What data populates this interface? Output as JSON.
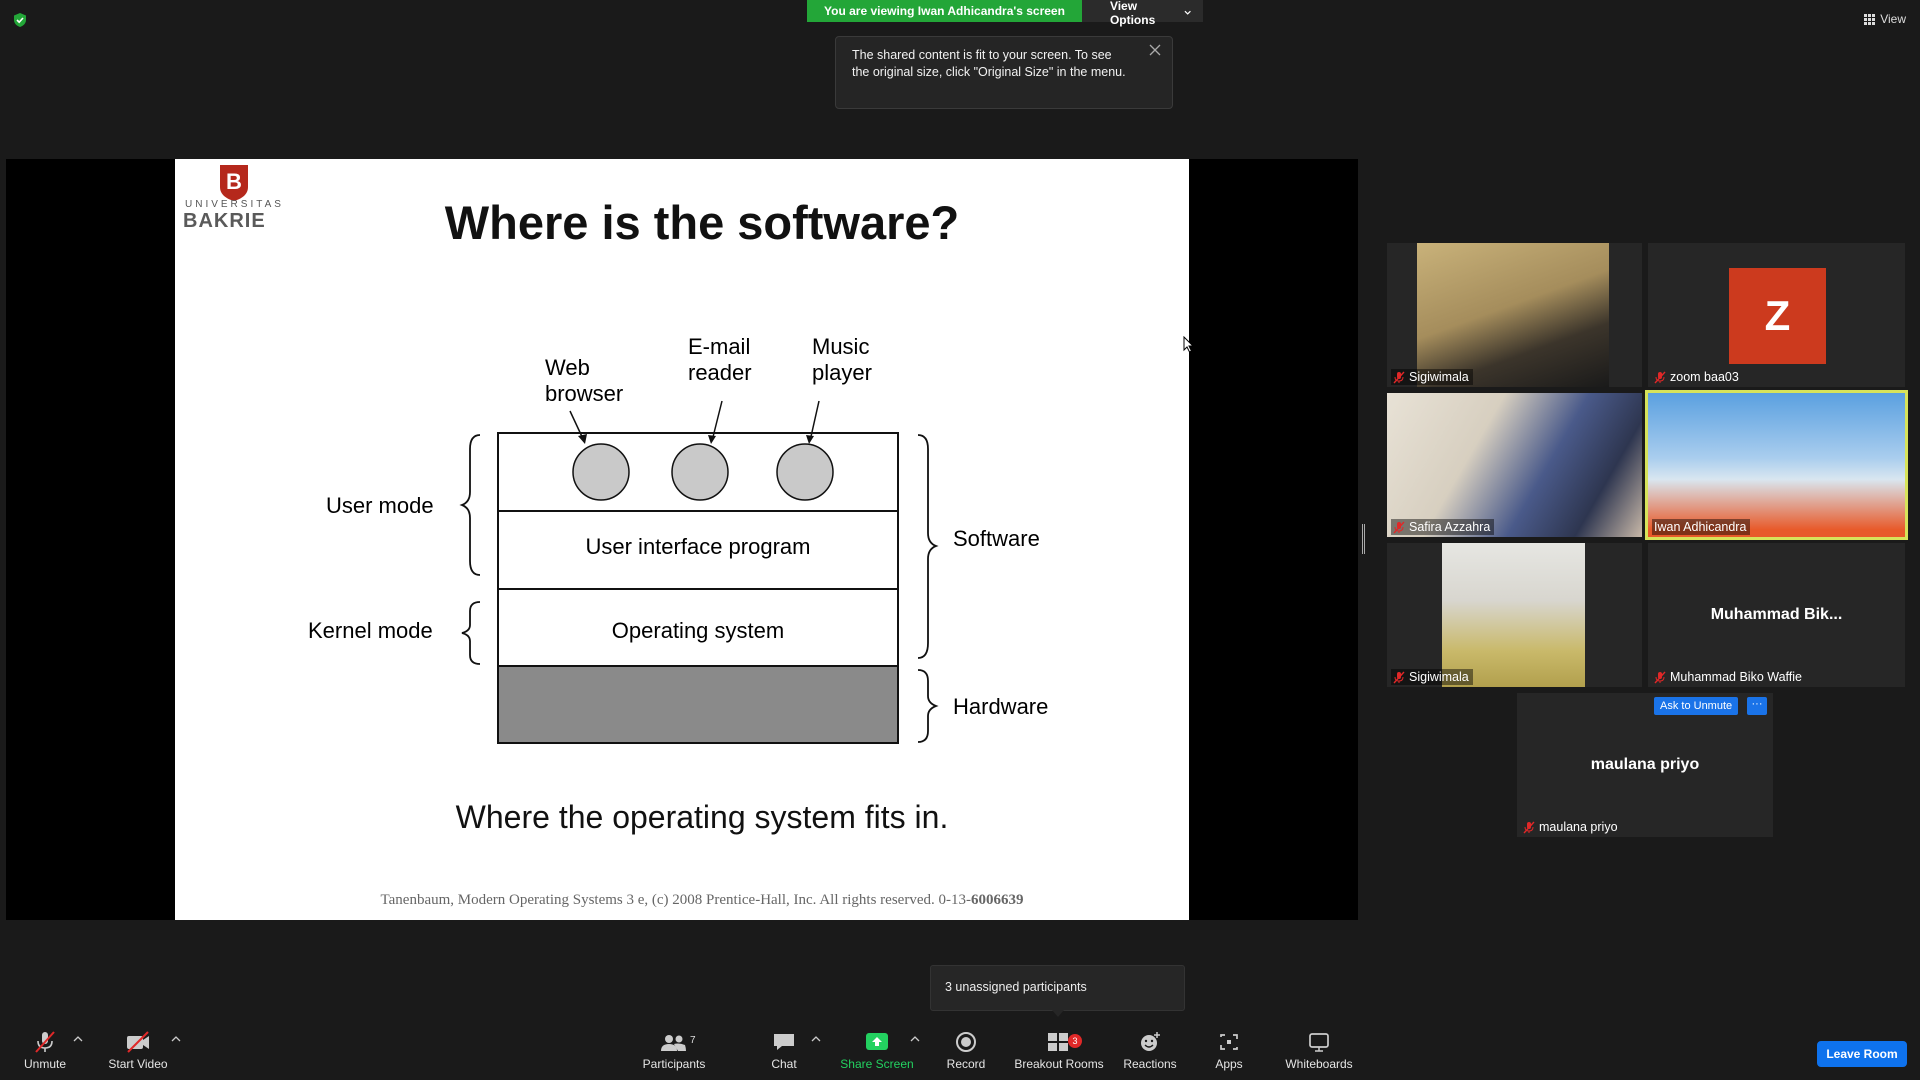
{
  "header": {
    "sharing_banner": "You are viewing Iwan Adhicandra's screen",
    "view_options": "View Options",
    "view_label": "View"
  },
  "tooltip": {
    "text": "The shared content is fit to your screen. To see the original size, click \"Original Size\" in the menu."
  },
  "slide": {
    "logo_top": "UNIVERSITAS",
    "logo_bottom": "BAKRIE",
    "title": "Where is the software?",
    "labels": {
      "web_browser_1": "Web",
      "web_browser_2": "browser",
      "email_1": "E-mail",
      "email_2": "reader",
      "music_1": "Music",
      "music_2": "player",
      "user_mode": "User mode",
      "kernel_mode": "Kernel mode",
      "ui_program": "User interface program",
      "os": "Operating system",
      "software": "Software",
      "hardware": "Hardware"
    },
    "caption": "Where the operating system fits in.",
    "footer": "Tanenbaum, Modern Operating Systems 3 e, (c) 2008 Prentice-Hall, Inc. All rights reserved. 0-13-",
    "footer_bold": "6006639"
  },
  "participants": [
    {
      "name": "Sigiwimala",
      "type": "video"
    },
    {
      "name": "zoom baa03",
      "type": "avatar",
      "initial": "Z"
    },
    {
      "name": "Safira Azzahra",
      "type": "video"
    },
    {
      "name": "Iwan Adhicandra",
      "type": "video",
      "active": true
    },
    {
      "name": "Sigiwimala",
      "type": "video"
    },
    {
      "name": "Muhammad Biko Waffie",
      "type": "name",
      "display": "Muhammad  Bik..."
    },
    {
      "name": "maulana priyo",
      "type": "name",
      "display": "maulana priyo"
    }
  ],
  "tile_actions": {
    "ask_to_unmute": "Ask to Unmute",
    "more": "···"
  },
  "popup": {
    "text": "3 unassigned participants"
  },
  "toolbar": {
    "unmute": "Unmute",
    "start_video": "Start Video",
    "participants": "Participants",
    "participants_count": "7",
    "chat": "Chat",
    "share_screen": "Share Screen",
    "record": "Record",
    "breakout_rooms": "Breakout Rooms",
    "breakout_badge": "3",
    "reactions": "Reactions",
    "apps": "Apps",
    "whiteboards": "Whiteboards",
    "leave": "Leave Room"
  },
  "colors": {
    "banner_green": "#23a638",
    "active_speaker": "#d7e35a",
    "leave_blue": "#0e72ed",
    "zoom_avatar": "#cc3a1e",
    "share_green": "#23d160"
  }
}
